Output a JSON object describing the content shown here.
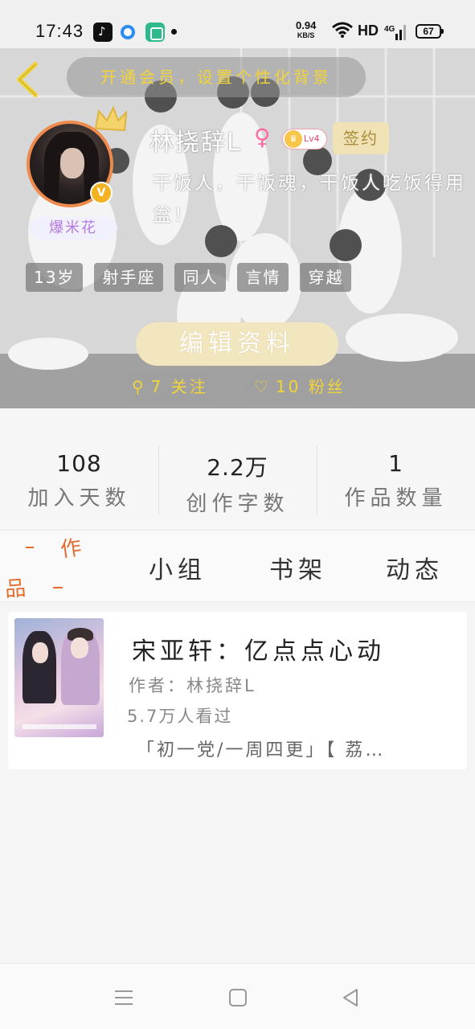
{
  "status_bar": {
    "time": "17:43",
    "speed_value": "0.94",
    "speed_unit": "KB/S",
    "hd": "HD",
    "network": "4G",
    "battery": "67"
  },
  "header": {
    "vip_banner": "开通会员，设置个性化背景",
    "username": "林挠辞L",
    "gender_symbol": "♀",
    "level": "Lv4",
    "sign_label": "签约",
    "bio": "干饭人，干饭魂，干饭人吃饭得用盆！",
    "badge_label": "爆米花",
    "verified_mark": "V",
    "tags": [
      "13岁",
      "射手座",
      "同人",
      "言情",
      "穿越"
    ],
    "edit_label": "编辑资料",
    "following_label": "7 关注",
    "fans_label": "10 粉丝"
  },
  "stats": [
    {
      "value": "108",
      "label": "加入天数"
    },
    {
      "value": "2.2万",
      "label": "创作字数"
    },
    {
      "value": "1",
      "label": "作品数量"
    }
  ],
  "tabs": {
    "works_part1": "作",
    "works_part2": "品",
    "group": "小组",
    "shelf": "书架",
    "feed": "动态"
  },
  "work": {
    "title": "宋亚轩：亿点点心动",
    "author": "作者：林挠辞L",
    "views": "5.7万人看过",
    "description": "「初一党/一周四更」【 荔…"
  },
  "colors": {
    "accent_yellow": "#f2d43a",
    "accent_orange": "#e56b2e",
    "avatar_ring": "#ee8a4c"
  }
}
